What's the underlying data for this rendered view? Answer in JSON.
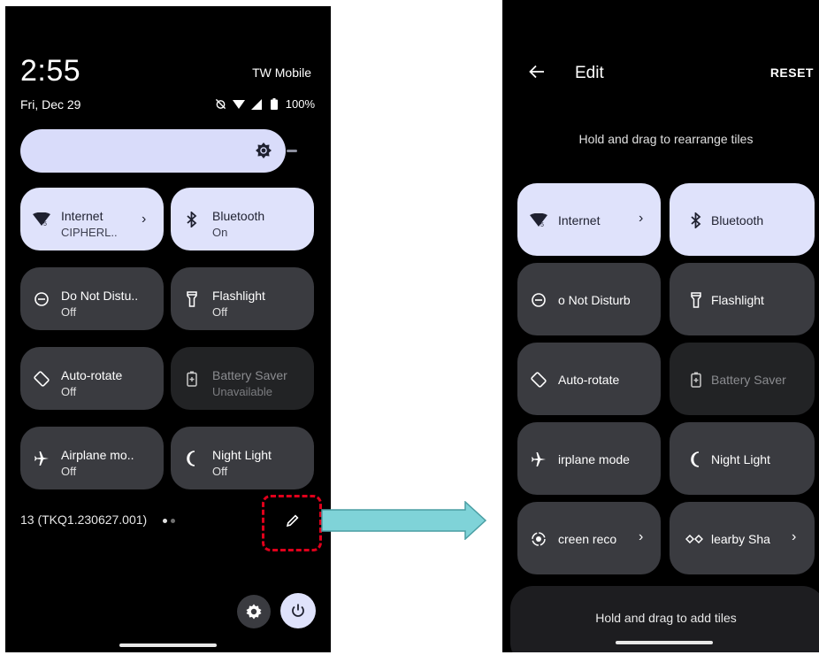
{
  "left_screen": {
    "time": "2:55",
    "date": "Fri, Dec 29",
    "carrier": "TW Mobile",
    "battery": "100%",
    "build": "13 (TKQ1.230627.001)",
    "tiles": [
      {
        "label": "Internet",
        "sub": "CIPHERL..",
        "icon": "wifi-icon",
        "state": "active",
        "chevron": true
      },
      {
        "label": "Bluetooth",
        "sub": "On",
        "icon": "bluetooth-icon",
        "state": "active",
        "chevron": false
      },
      {
        "label": "Do Not Distu..",
        "sub": "Off",
        "icon": "do-not-disturb-icon",
        "state": "off",
        "chevron": false
      },
      {
        "label": "Flashlight",
        "sub": "Off",
        "icon": "flashlight-icon",
        "state": "off",
        "chevron": false
      },
      {
        "label": "Auto-rotate",
        "sub": "Off",
        "icon": "auto-rotate-icon",
        "state": "off",
        "chevron": false
      },
      {
        "label": "Battery Saver",
        "sub": "Unavailable",
        "icon": "battery-saver-icon",
        "state": "unavailable",
        "chevron": false
      },
      {
        "label": "Airplane mo..",
        "sub": "Off",
        "icon": "airplane-icon",
        "state": "off",
        "chevron": false
      },
      {
        "label": "Night Light",
        "sub": "Off",
        "icon": "night-light-icon",
        "state": "off",
        "chevron": false
      }
    ]
  },
  "right_screen": {
    "title": "Edit",
    "reset": "RESET",
    "hint": "Hold and drag to rearrange tiles",
    "add_hint": "Hold and drag to add tiles",
    "tiles": [
      {
        "label": "Internet",
        "icon": "wifi-icon",
        "state": "active",
        "chevron": true
      },
      {
        "label": "Bluetooth",
        "icon": "bluetooth-icon",
        "state": "active",
        "chevron": false
      },
      {
        "label": "o Not Disturb",
        "icon": "do-not-disturb-icon",
        "state": "off",
        "chevron": false
      },
      {
        "label": "Flashlight",
        "icon": "flashlight-icon",
        "state": "off",
        "chevron": false
      },
      {
        "label": "Auto-rotate",
        "icon": "auto-rotate-icon",
        "state": "off",
        "chevron": false
      },
      {
        "label": "Battery Saver",
        "icon": "battery-saver-icon",
        "state": "unavailable",
        "chevron": false
      },
      {
        "label": "irplane mode",
        "icon": "airplane-icon",
        "state": "off",
        "chevron": false
      },
      {
        "label": "Night Light",
        "icon": "night-light-icon",
        "state": "off",
        "chevron": false
      },
      {
        "label": "creen reco",
        "icon": "screen-record-icon",
        "state": "off",
        "chevron": true
      },
      {
        "label": "learby Sha",
        "icon": "nearby-share-icon",
        "state": "off",
        "chevron": true
      }
    ]
  },
  "colors": {
    "tile_active": "#dfe2fb",
    "tile_off": "#3a3b40",
    "tile_unavailable": "#222325",
    "highlight": "#e0001b",
    "arrow": "#7fd3d8"
  }
}
